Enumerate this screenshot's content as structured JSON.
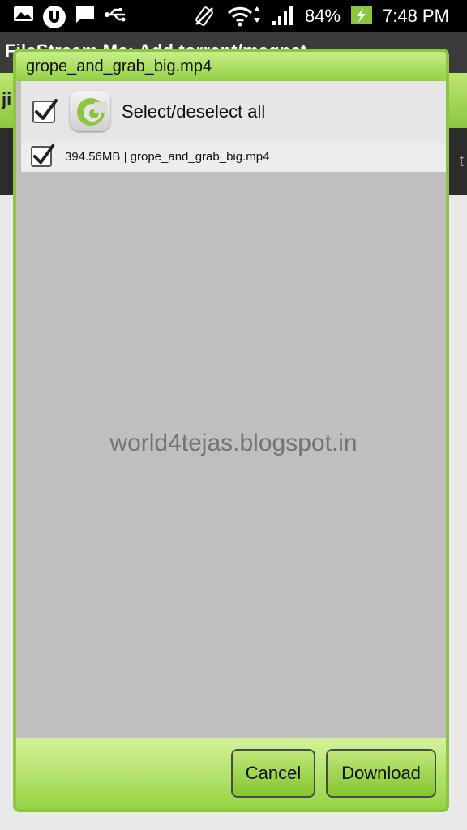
{
  "status_bar": {
    "battery_percent": "84%",
    "time": "7:48 PM",
    "icons": [
      "gallery-icon",
      "utorrent-icon",
      "message-icon",
      "usb-icon",
      "vibrate-off-icon",
      "wifi-icon",
      "signal-icon",
      "battery-charging-icon"
    ]
  },
  "background_app": {
    "title": "FileStream Me: Add torrent/magnet",
    "header_text": "ji",
    "right_text": "t"
  },
  "dialog": {
    "title": "grope_and_grab_big.mp4",
    "select_all_label": "Select/deselect all",
    "select_all_checked": true,
    "app_icon": "app-logo-icon",
    "files": [
      {
        "size": "394.56MB",
        "separator": "|",
        "name": "grope_and_grab_big.mp4",
        "checked": true
      }
    ],
    "watermark": "world4tejas.blogspot.in",
    "cancel_label": "Cancel",
    "download_label": "Download"
  },
  "colors": {
    "accent_green": "#8cc63f",
    "dialog_body": "#c0bfbd"
  }
}
